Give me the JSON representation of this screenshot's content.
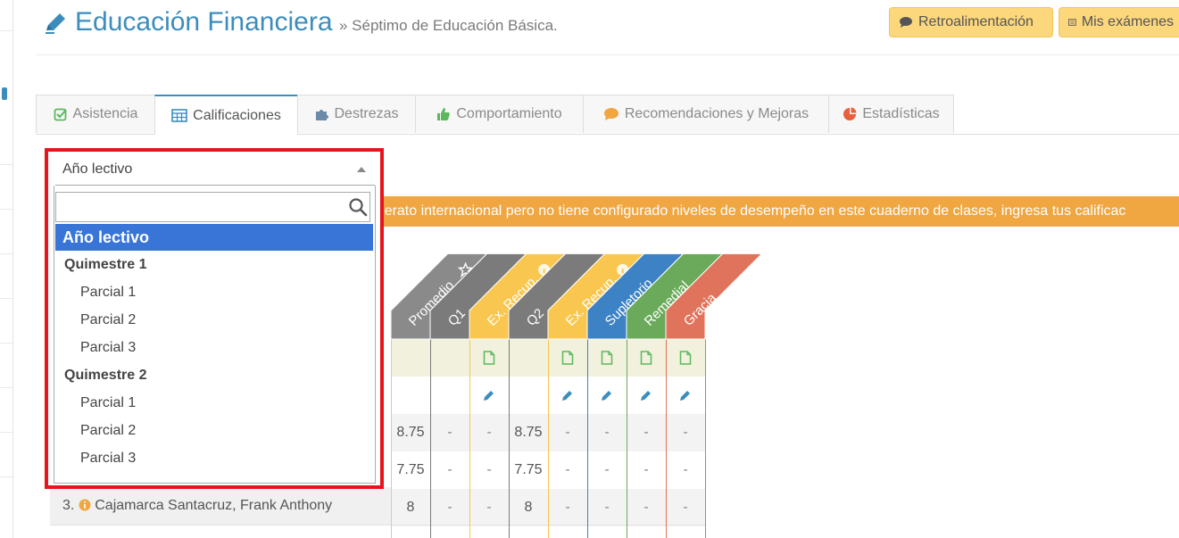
{
  "header": {
    "title": "Educación Financiera",
    "subtitle": "» Séptimo de Educación Básica.",
    "buttons": [
      {
        "label": "Retroalimentación",
        "icon": "chat-icon"
      },
      {
        "label": "Mis exámenes",
        "icon": "list-icon"
      }
    ]
  },
  "tabs": [
    {
      "label": "Asistencia",
      "icon": "check-square-icon",
      "active": false
    },
    {
      "label": "Calificaciones",
      "icon": "table-icon",
      "active": true
    },
    {
      "label": "Destrezas",
      "icon": "puzzle-icon",
      "active": false
    },
    {
      "label": "Comportamiento",
      "icon": "thumbs-up-icon",
      "active": false
    },
    {
      "label": "Recomendaciones y Mejoras",
      "icon": "comment-icon",
      "active": false
    },
    {
      "label": "Estadísticas",
      "icon": "pie-chart-icon",
      "active": false
    }
  ],
  "warning": "illerato internacional pero no tiene configurado niveles de desempeño en este cuaderno de clases, ingresa tus calificac",
  "dropdown": {
    "selected": "Año lectivo",
    "search_value": "",
    "options": [
      {
        "label": "Año lectivo",
        "kind": "highlighted"
      },
      {
        "label": "Quimestre 1",
        "kind": "group"
      },
      {
        "label": "Parcial 1",
        "kind": "sub"
      },
      {
        "label": "Parcial 2",
        "kind": "sub"
      },
      {
        "label": "Parcial 3",
        "kind": "sub"
      },
      {
        "label": "Quimestre 2",
        "kind": "group"
      },
      {
        "label": "Parcial 1",
        "kind": "sub"
      },
      {
        "label": "Parcial 2",
        "kind": "sub"
      },
      {
        "label": "Parcial 3",
        "kind": "sub"
      }
    ]
  },
  "columns": [
    {
      "label": "Promedio",
      "color": "#8a8a8a",
      "badge": "star-icon"
    },
    {
      "label": "Q1",
      "color": "#7b7b7b",
      "badge": ""
    },
    {
      "label": "Ex. Recup.",
      "color": "#f9c74f",
      "badge": "info-icon"
    },
    {
      "label": "Q2",
      "color": "#7b7b7b",
      "badge": ""
    },
    {
      "label": "Ex. Recup.",
      "color": "#f9c74f",
      "badge": "info-icon"
    },
    {
      "label": "Supletorio",
      "color": "#3c82c4",
      "badge": ""
    },
    {
      "label": "Remedial",
      "color": "#6aaa5a",
      "badge": ""
    },
    {
      "label": "Gracia",
      "color": "#e0735b",
      "badge": ""
    }
  ],
  "rows": [
    {
      "values": [
        "8.75",
        "-",
        "-",
        "8.75",
        "-",
        "-",
        "-",
        "-"
      ]
    },
    {
      "values": [
        "7.75",
        "-",
        "-",
        "7.75",
        "-",
        "-",
        "-",
        "-"
      ]
    },
    {
      "name": "3.",
      "student": "Cajamarca Santacruz, Frank Anthony",
      "values": [
        "8",
        "-",
        "-",
        "8",
        "-",
        "-",
        "-",
        "-"
      ]
    }
  ]
}
